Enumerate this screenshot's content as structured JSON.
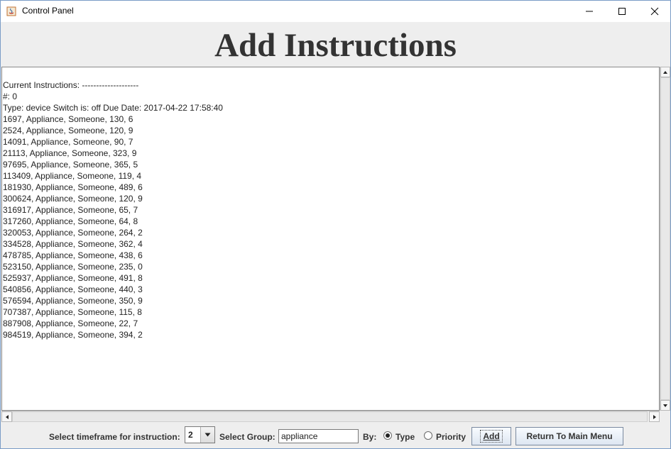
{
  "window": {
    "title": "Control Panel"
  },
  "heading": "Add Instructions",
  "instructions": {
    "lines": [
      "Current Instructions: --------------------",
      "#: 0",
      "Type: device Switch is: off Due Date: 2017-04-22 17:58:40",
      "1697, Appliance, Someone, 130, 6",
      "2524, Appliance, Someone, 120, 9",
      "14091, Appliance, Someone, 90, 7",
      "21113, Appliance, Someone, 323, 9",
      "97695, Appliance, Someone, 365, 5",
      "113409, Appliance, Someone, 119, 4",
      "181930, Appliance, Someone, 489, 6",
      "300624, Appliance, Someone, 120, 9",
      "316917, Appliance, Someone, 65, 7",
      "317260, Appliance, Someone, 64, 8",
      "320053, Appliance, Someone, 264, 2",
      "334528, Appliance, Someone, 362, 4",
      "478785, Appliance, Someone, 438, 6",
      "523150, Appliance, Someone, 235, 0",
      "525937, Appliance, Someone, 491, 8",
      "540856, Appliance, Someone, 440, 3",
      "576594, Appliance, Someone, 350, 9",
      "707387, Appliance, Someone, 115, 8",
      "887908, Appliance, Someone, 22, 7",
      "984519, Appliance, Someone, 394, 2"
    ]
  },
  "controls": {
    "timeframe_label": "Select timeframe for instruction:",
    "timeframe_value": "2",
    "group_label": "Select Group:",
    "group_value": "appliance",
    "by_label": "By:",
    "radio_type_label": "Type",
    "radio_priority_label": "Priority",
    "radio_selected": "Type",
    "add_button": "Add",
    "return_button": "Return To Main Menu"
  }
}
